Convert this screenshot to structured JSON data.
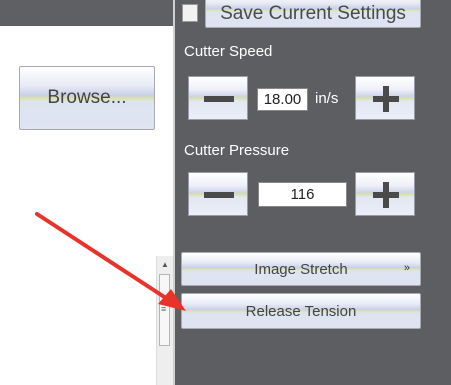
{
  "save_settings": {
    "label": "Save Current Settings",
    "checked": false
  },
  "browse": {
    "label": "Browse..."
  },
  "cutter_speed": {
    "label": "Cutter Speed",
    "value": "18.00",
    "unit": "in/s"
  },
  "cutter_pressure": {
    "label": "Cutter Pressure",
    "value": "116"
  },
  "image_stretch": {
    "label": "Image Stretch",
    "chevron": "»"
  },
  "release_tension": {
    "label": "Release Tension"
  },
  "scrollbar": {
    "up_glyph": "▲",
    "grip_glyph": "≡"
  },
  "colors": {
    "sidebar_bg": "#5d5e62",
    "annotation_arrow": "#e8322a",
    "label_text": "#ffffff"
  },
  "icons": {
    "minus": "minus-icon",
    "plus": "plus-icon"
  }
}
